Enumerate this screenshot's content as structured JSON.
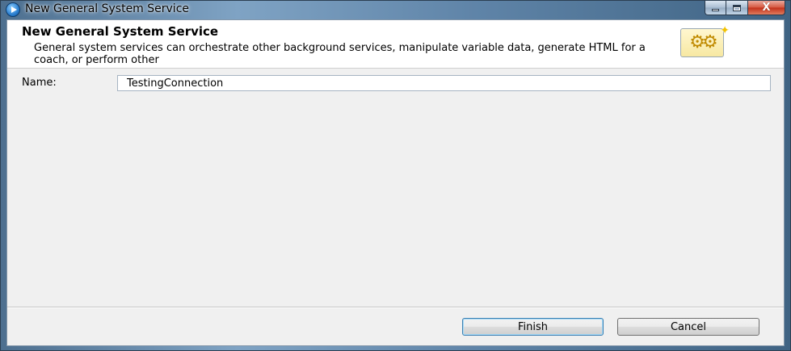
{
  "window": {
    "title": "New General System Service",
    "controls": {
      "minimize_icon": "minimize-icon",
      "maximize_icon": "maximize-icon",
      "close_icon": "close-icon",
      "close_glyph": "X"
    },
    "app_icon": "play-icon"
  },
  "header": {
    "title": "New General System Service",
    "description": "General system services can orchestrate other background services, manipulate variable data, generate HTML for a coach, or perform other",
    "banner_icon": "gears-icon",
    "gears_glyph": "⚙⚙",
    "spark_glyph": "✦"
  },
  "form": {
    "name_label": "Name:",
    "name_value": "TestingConnection"
  },
  "buttons": {
    "finish_label": "Finish",
    "cancel_label": "Cancel"
  },
  "colors": {
    "accent_button_border": "#3c7fb1",
    "close_button": "#c1301a"
  }
}
